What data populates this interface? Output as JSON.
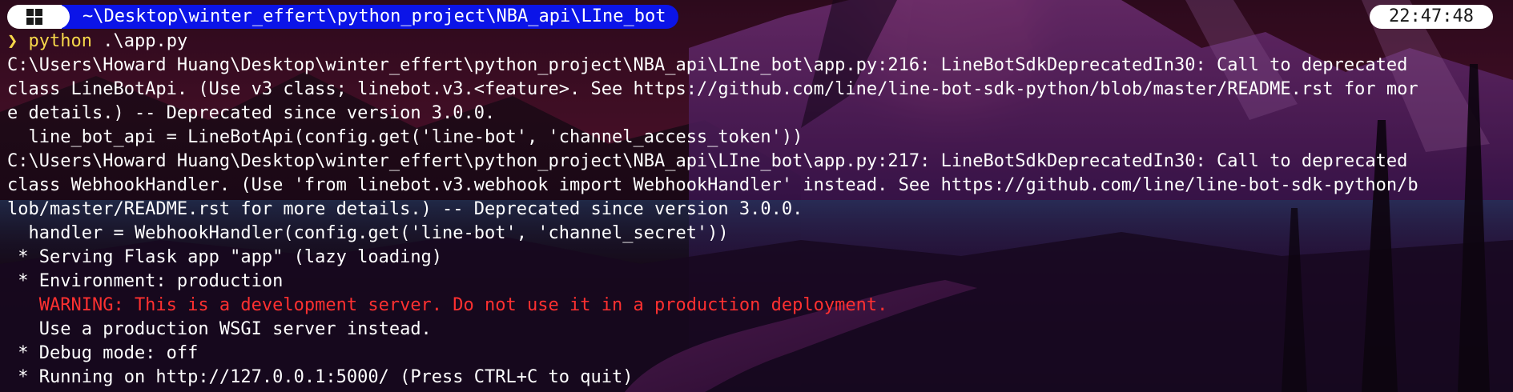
{
  "prompt": {
    "path": "~\\Desktop\\winter_effert\\python_project\\NBA_api\\LIne_bot",
    "time": "22:47:48"
  },
  "command": {
    "chevron": "❯",
    "program": "python",
    "argument": ".\\app.py"
  },
  "output": [
    {
      "text": "C:\\Users\\Howard Huang\\Desktop\\winter_effert\\python_project\\NBA_api\\LIne_bot\\app.py:216: LineBotSdkDeprecatedIn30: Call to deprecated",
      "type": "normal"
    },
    {
      "text": "class LineBotApi. (Use v3 class; linebot.v3.<feature>. See https://github.com/line/line-bot-sdk-python/blob/master/README.rst for mor",
      "type": "normal"
    },
    {
      "text": "e details.) -- Deprecated since version 3.0.0.",
      "type": "normal"
    },
    {
      "text": "  line_bot_api = LineBotApi(config.get('line-bot', 'channel_access_token'))",
      "type": "normal"
    },
    {
      "text": "C:\\Users\\Howard Huang\\Desktop\\winter_effert\\python_project\\NBA_api\\LIne_bot\\app.py:217: LineBotSdkDeprecatedIn30: Call to deprecated",
      "type": "normal"
    },
    {
      "text": "class WebhookHandler. (Use 'from linebot.v3.webhook import WebhookHandler' instead. See https://github.com/line/line-bot-sdk-python/b",
      "type": "normal"
    },
    {
      "text": "lob/master/README.rst for more details.) -- Deprecated since version 3.0.0.",
      "type": "normal"
    },
    {
      "text": "  handler = WebhookHandler(config.get('line-bot', 'channel_secret'))",
      "type": "normal"
    },
    {
      "text": " * Serving Flask app \"app\" (lazy loading)",
      "type": "normal"
    },
    {
      "text": " * Environment: production",
      "type": "normal"
    },
    {
      "text": "   WARNING: This is a development server. Do not use it in a production deployment.",
      "type": "warning"
    },
    {
      "text": "   Use a production WSGI server instead.",
      "type": "normal"
    },
    {
      "text": " * Debug mode: off",
      "type": "normal"
    },
    {
      "text": " * Running on http://127.0.0.1:5000/ (Press CTRL+C to quit)",
      "type": "normal"
    }
  ],
  "colors": {
    "path_segment": "#0b14e8",
    "prompt_yellow": "#f6d74a",
    "warning_red": "#ff3030"
  },
  "icons": {
    "os": "windows-icon"
  }
}
